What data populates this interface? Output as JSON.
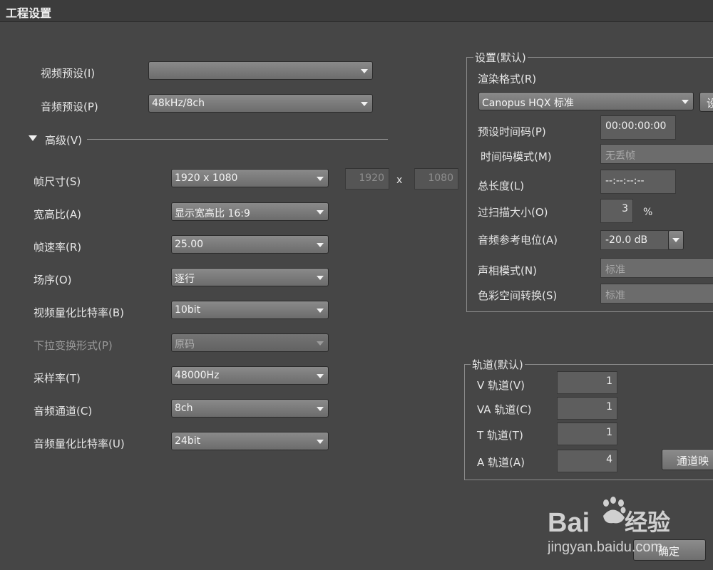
{
  "window": {
    "title": "工程设置"
  },
  "presets": {
    "video_label": "视频预设(I)",
    "video_value": "",
    "audio_label": "音频预设(P)",
    "audio_value": "48kHz/8ch"
  },
  "advanced": {
    "label": "高级(V)"
  },
  "fields": {
    "frame_size_label": "帧尺寸(S)",
    "frame_size_value": "1920 x 1080",
    "width_value": "1920",
    "x_sep": "x",
    "height_value": "1080",
    "aspect_label": "宽高比(A)",
    "aspect_value": "显示宽高比 16:9",
    "frame_rate_label": "帧速率(R)",
    "frame_rate_value": "25.00",
    "field_order_label": "场序(O)",
    "field_order_value": "逐行",
    "video_bits_label": "视频量化比特率(B)",
    "video_bits_value": "10bit",
    "pulldown_label": "下拉变换形式(P)",
    "pulldown_value": "原码",
    "sample_rate_label": "采样率(T)",
    "sample_rate_value": "48000Hz",
    "audio_channels_label": "音频通道(C)",
    "audio_channels_value": "8ch",
    "audio_bits_label": "音频量化比特率(U)",
    "audio_bits_value": "24bit"
  },
  "defaults": {
    "legend": "设置(默认)",
    "render_format_label": "渲染格式(R)",
    "render_format_value": "Canopus HQX 标准",
    "render_settings_button": "设",
    "preset_tc_label": "预设时间码(P)",
    "preset_tc_value": "00:00:00:00",
    "tc_mode_label": "时间码模式(M)",
    "tc_mode_value": "无丢帧",
    "total_length_label": "总长度(L)",
    "total_length_value": "--:--:--:--",
    "overscan_label": "过扫描大小(O)",
    "overscan_value": "3",
    "overscan_unit": "%",
    "audio_ref_label": "音频参考电位(A)",
    "audio_ref_value": "-20.0 dB",
    "pan_mode_label": "声相模式(N)",
    "pan_mode_value": "标准",
    "color_space_label": "色彩空间转换(S)",
    "color_space_value": "标准"
  },
  "tracks": {
    "legend": "轨道(默认)",
    "v_label": "V 轨道(V)",
    "v_value": "1",
    "va_label": "VA 轨道(C)",
    "va_value": "1",
    "t_label": "T 轨道(T)",
    "t_value": "1",
    "a_label": "A 轨道(A)",
    "a_value": "4",
    "channel_map_button": "通道映"
  },
  "footer": {
    "ok_button": "确定"
  },
  "watermark": {
    "brand": "Bai经验",
    "url": "jingyan.baidu.com"
  }
}
